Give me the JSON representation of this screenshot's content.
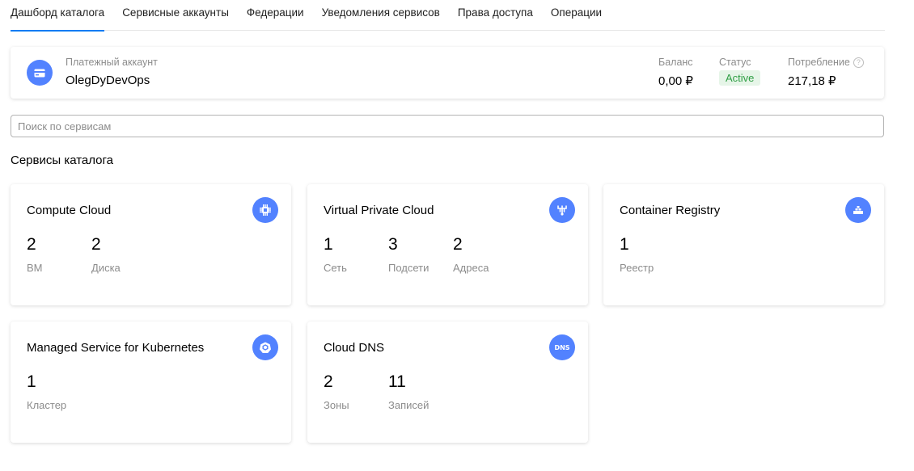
{
  "tabs": [
    {
      "label": "Дашборд каталога",
      "active": true
    },
    {
      "label": "Сервисные аккаунты"
    },
    {
      "label": "Федерации"
    },
    {
      "label": "Уведомления сервисов"
    },
    {
      "label": "Права доступа"
    },
    {
      "label": "Операции"
    }
  ],
  "billing": {
    "label": "Платежный аккаунт",
    "name": "OlegDyDevOps",
    "icon": "credit-card-icon",
    "balance_label": "Баланс",
    "balance_value": "0,00 ₽",
    "status_label": "Статус",
    "status_value": "Active",
    "consumption_label": "Потребление",
    "consumption_value": "217,18 ₽",
    "help_glyph": "?"
  },
  "search": {
    "placeholder": "Поиск по сервисам",
    "value": ""
  },
  "section_title": "Сервисы каталога",
  "colors": {
    "accent": "#027bf3",
    "icon_bg": "#5282ff",
    "status_bg": "#e6f5e8",
    "status_text": "#2f9e44",
    "muted": "#8c8c8c"
  },
  "cards": [
    {
      "title": "Compute Cloud",
      "icon": "cpu-icon",
      "metrics": [
        {
          "value": "2",
          "label": "ВМ"
        },
        {
          "value": "2",
          "label": "Диска"
        }
      ]
    },
    {
      "title": "Virtual Private Cloud",
      "icon": "network-icon",
      "metrics": [
        {
          "value": "1",
          "label": "Сеть"
        },
        {
          "value": "3",
          "label": "Подсети"
        },
        {
          "value": "2",
          "label": "Адреса"
        }
      ]
    },
    {
      "title": "Container Registry",
      "icon": "registry-icon",
      "metrics": [
        {
          "value": "1",
          "label": "Реестр"
        }
      ]
    },
    {
      "title": "Managed Service for Kubernetes",
      "icon": "kubernetes-icon",
      "metrics": [
        {
          "value": "1",
          "label": "Кластер"
        }
      ]
    },
    {
      "title": "Cloud DNS",
      "icon": "dns-icon",
      "icon_text": "DNS",
      "metrics": [
        {
          "value": "2",
          "label": "Зоны"
        },
        {
          "value": "11",
          "label": "Записей"
        }
      ]
    }
  ]
}
